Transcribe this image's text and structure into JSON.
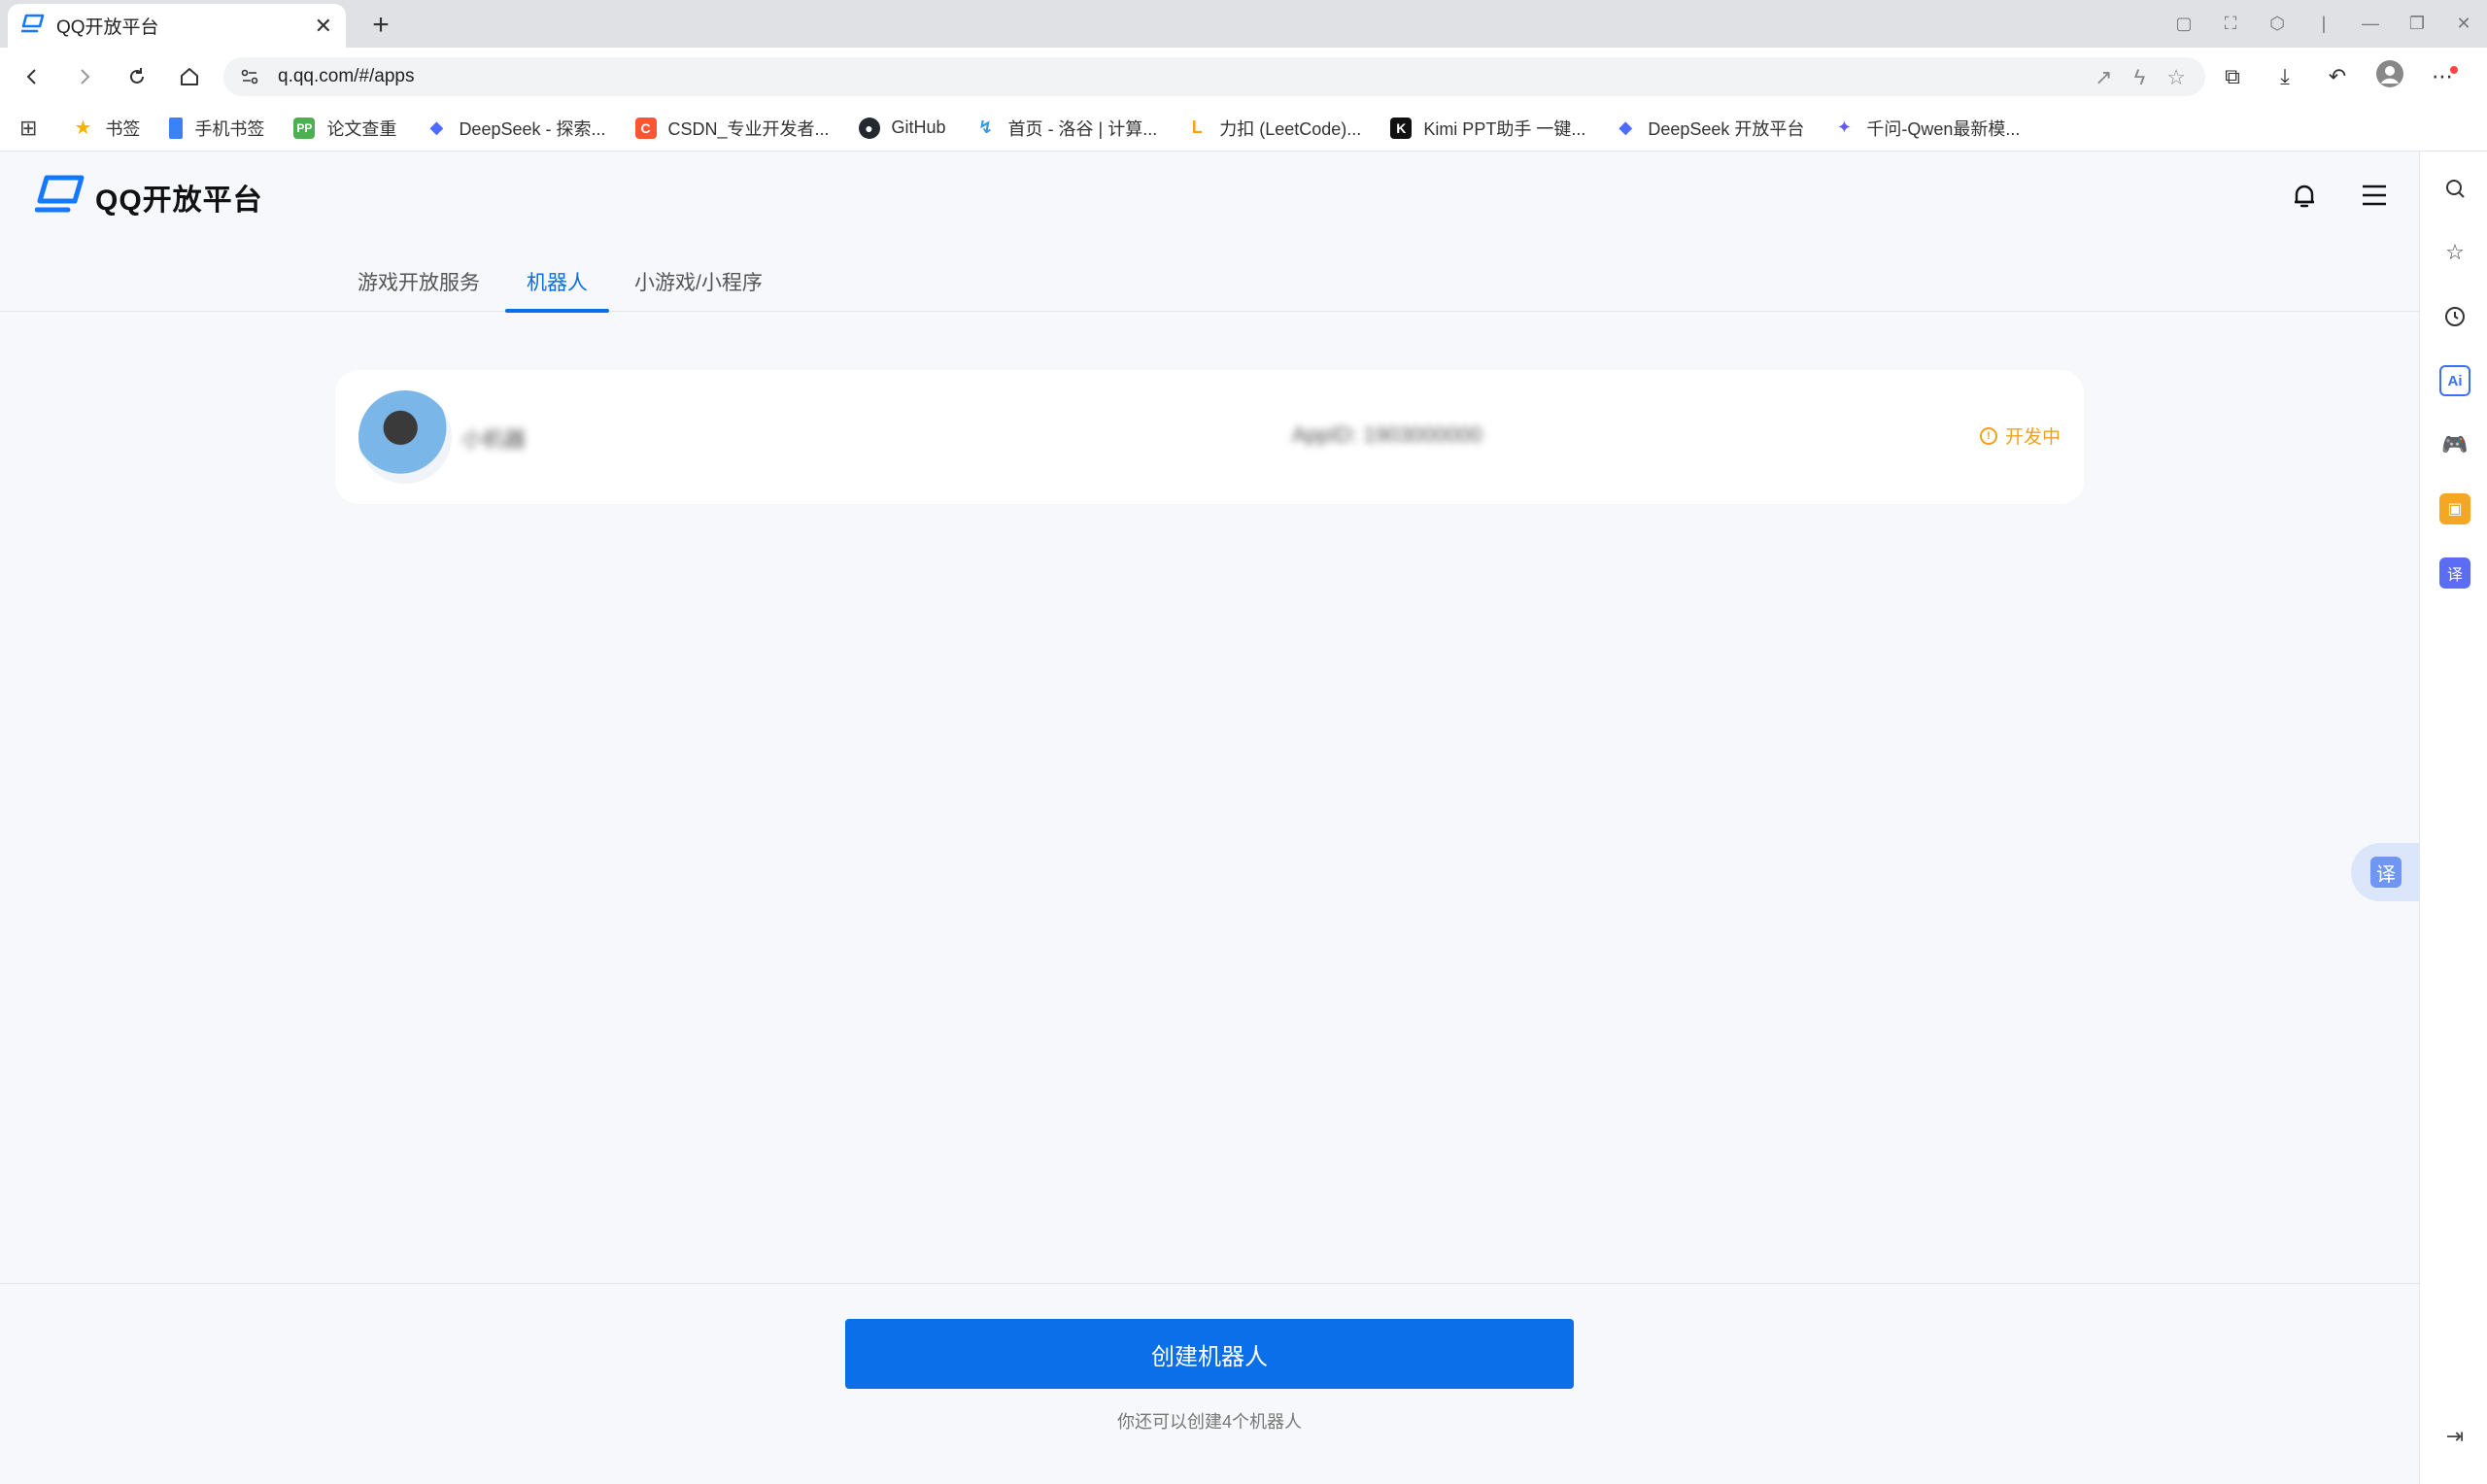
{
  "browser": {
    "tab_title": "QQ开放平台",
    "url": "q.qq.com/#/apps",
    "bookmarks": [
      {
        "label": "书签",
        "color": "#f6b400",
        "glyph": "★"
      },
      {
        "label": "手机书签",
        "color": "#3b82f6",
        "glyph": ""
      },
      {
        "label": "论文查重",
        "color": "#4caf50",
        "glyph": "PP"
      },
      {
        "label": "DeepSeek - 探索...",
        "color": "#4d6bfe",
        "glyph": "◆"
      },
      {
        "label": "CSDN_专业开发者...",
        "color": "#fc5531",
        "glyph": "C"
      },
      {
        "label": "GitHub",
        "color": "#24292f",
        "glyph": "●"
      },
      {
        "label": "首页 - 洛谷 | 计算...",
        "color": "#3498db",
        "glyph": "↯"
      },
      {
        "label": "力扣 (LeetCode)...",
        "color": "#ffa116",
        "glyph": "L"
      },
      {
        "label": "Kimi PPT助手 一键...",
        "color": "#111111",
        "glyph": "K"
      },
      {
        "label": "DeepSeek 开放平台",
        "color": "#4d6bfe",
        "glyph": "◆"
      },
      {
        "label": "千问-Qwen最新模...",
        "color": "#615ced",
        "glyph": "✦"
      }
    ]
  },
  "page": {
    "logo_text": "QQ开放平台",
    "tabs": [
      {
        "label": "游戏开放服务"
      },
      {
        "label": "机器人"
      },
      {
        "label": "小游戏/小程序"
      }
    ],
    "bot": {
      "name": "小机器",
      "app_id": "AppID: 1903000000",
      "status": "开发中"
    },
    "translate_label": "译",
    "create_button": "创建机器人",
    "create_hint": "你还可以创建4个机器人"
  },
  "colors": {
    "accent": "#0a6fe8",
    "status": "#f0a020"
  }
}
